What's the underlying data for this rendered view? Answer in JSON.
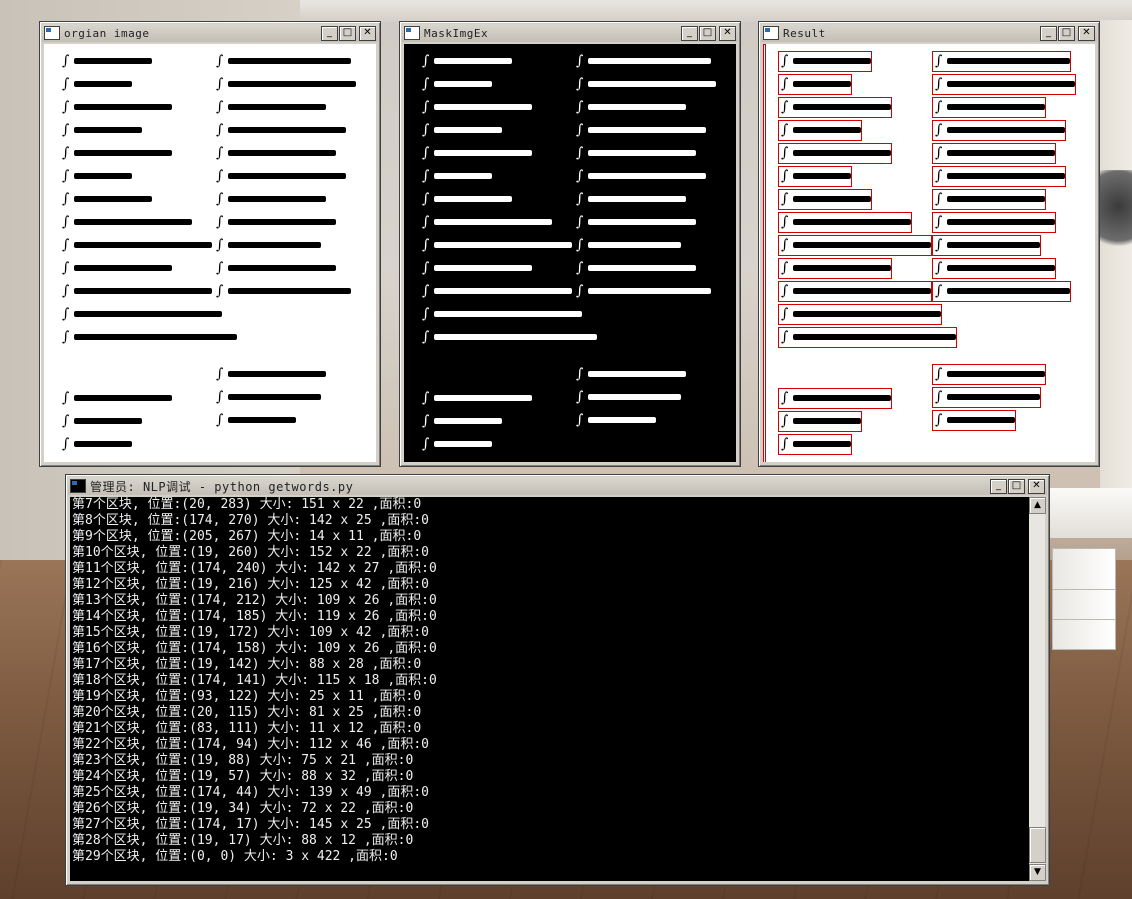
{
  "windows": {
    "original": {
      "title": "orgian image"
    },
    "mask": {
      "title": "MaskImgEx"
    },
    "result": {
      "title": "Result"
    },
    "console": {
      "title": "管理员: NLP调试 - python  getwords.py",
      "lines": [
        "第7个区块, 位置:(20, 283) 大小: 151 x 22 ,面积:0",
        "第8个区块, 位置:(174, 270) 大小: 142 x 25 ,面积:0",
        "第9个区块, 位置:(205, 267) 大小: 14 x 11 ,面积:0",
        "第10个区块, 位置:(19, 260) 大小: 152 x 22 ,面积:0",
        "第11个区块, 位置:(174, 240) 大小: 142 x 27 ,面积:0",
        "第12个区块, 位置:(19, 216) 大小: 125 x 42 ,面积:0",
        "第13个区块, 位置:(174, 212) 大小: 109 x 26 ,面积:0",
        "第14个区块, 位置:(174, 185) 大小: 119 x 26 ,面积:0",
        "第15个区块, 位置:(19, 172) 大小: 109 x 42 ,面积:0",
        "第16个区块, 位置:(174, 158) 大小: 109 x 26 ,面积:0",
        "第17个区块, 位置:(19, 142) 大小: 88 x 28 ,面积:0",
        "第18个区块, 位置:(174, 141) 大小: 115 x 18 ,面积:0",
        "第19个区块, 位置:(93, 122) 大小: 25 x 11 ,面积:0",
        "第20个区块, 位置:(20, 115) 大小: 81 x 25 ,面积:0",
        "第21个区块, 位置:(83, 111) 大小: 11 x 12 ,面积:0",
        "第22个区块, 位置:(174, 94) 大小: 112 x 46 ,面积:0",
        "第23个区块, 位置:(19, 88) 大小: 75 x 21 ,面积:0",
        "第24个区块, 位置:(19, 57) 大小: 88 x 32 ,面积:0",
        "第25个区块, 位置:(174, 44) 大小: 139 x 49 ,面积:0",
        "第26个区块, 位置:(19, 34) 大小: 72 x 22 ,面积:0",
        "第27个区块, 位置:(174, 17) 大小: 145 x 25 ,面积:0",
        "第28个区块, 位置:(19, 17) 大小: 88 x 12 ,面积:0",
        "第29个区块, 位置:(0, 0) 大小: 3 x 422 ,面积:0"
      ]
    }
  },
  "colors": {
    "window_face": "#d4d0c8",
    "console_bg": "#000000",
    "console_text": "#f0f0f0",
    "box_red": "#d40000"
  },
  "icons": {
    "minimize": "minimize-icon",
    "maximize": "maximize-icon",
    "close": "close-icon",
    "scroll_up": "scroll-up-icon",
    "scroll_down": "scroll-down-icon"
  }
}
